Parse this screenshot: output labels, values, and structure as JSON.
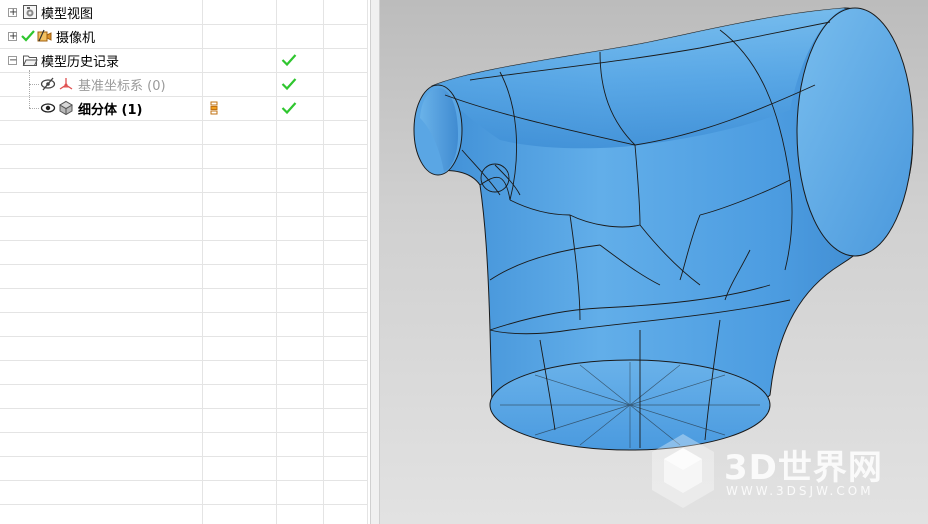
{
  "navigator": {
    "nodes": [
      {
        "label": "模型视图"
      },
      {
        "label": "摄像机"
      },
      {
        "label": "模型历史记录"
      },
      {
        "label": "基准坐标系 (0)"
      },
      {
        "label": "细分体 (1)"
      }
    ],
    "expanders": [
      "+",
      "+",
      "−"
    ]
  },
  "colors": {
    "check": "#2fc62f",
    "model_blue": "#5aa8e6",
    "model_edge": "#1a1a1a",
    "viewport_top": "#bcbcbc",
    "viewport_bottom": "#e2e2e2"
  },
  "watermark": {
    "brand": "3D世界网",
    "url": "WWW.3DSJW.COM"
  }
}
